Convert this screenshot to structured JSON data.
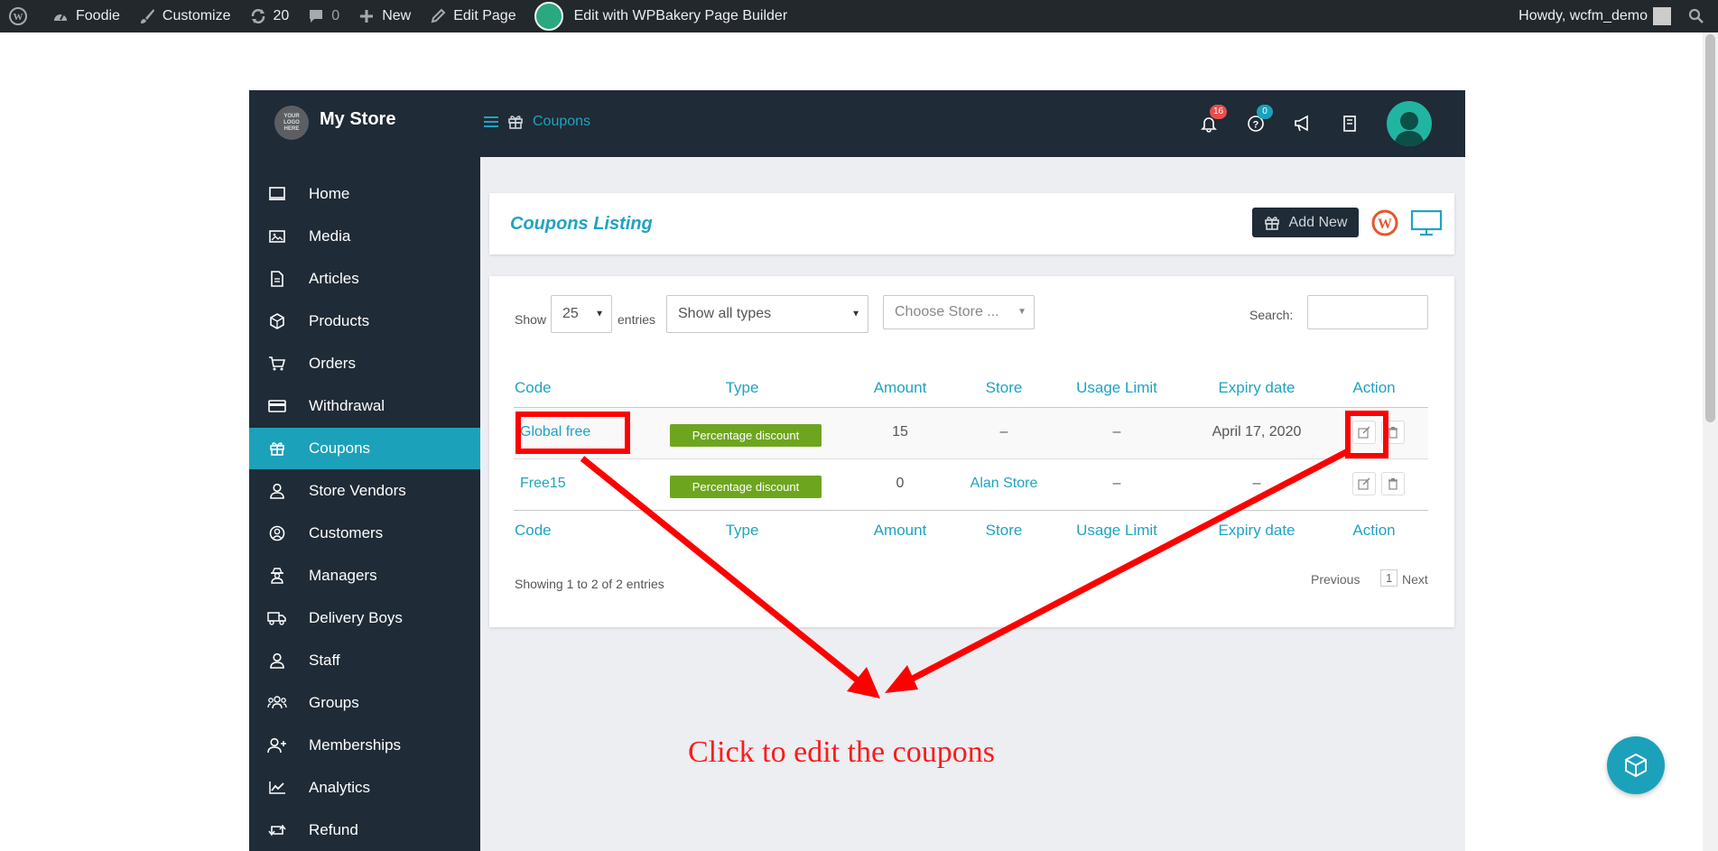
{
  "adminbar": {
    "site": "Foodie",
    "customize": "Customize",
    "updates": "20",
    "comments": "0",
    "new": "New",
    "edit_page": "Edit Page",
    "wpbakery": "Edit with WPBakery Page Builder",
    "howdy": "Howdy, wcfm_demo"
  },
  "header": {
    "logo_text": "YOUR LOGO HERE",
    "store_name": "My Store",
    "breadcrumb": "Coupons",
    "notifications_count": "16",
    "help_count": "0"
  },
  "sidebar": {
    "items": [
      {
        "label": "Home",
        "icon": "monitor-icon"
      },
      {
        "label": "Media",
        "icon": "image-icon"
      },
      {
        "label": "Articles",
        "icon": "document-icon"
      },
      {
        "label": "Products",
        "icon": "cube-icon"
      },
      {
        "label": "Orders",
        "icon": "cart-icon"
      },
      {
        "label": "Withdrawal",
        "icon": "credit-card-icon"
      },
      {
        "label": "Coupons",
        "icon": "gift-icon",
        "active": true
      },
      {
        "label": "Store Vendors",
        "icon": "user-icon"
      },
      {
        "label": "Customers",
        "icon": "user-circle-icon"
      },
      {
        "label": "Managers",
        "icon": "user-secret-icon"
      },
      {
        "label": "Delivery Boys",
        "icon": "truck-icon"
      },
      {
        "label": "Staff",
        "icon": "user-icon"
      },
      {
        "label": "Groups",
        "icon": "users-icon"
      },
      {
        "label": "Memberships",
        "icon": "user-plus-icon"
      },
      {
        "label": "Analytics",
        "icon": "chart-line-icon"
      },
      {
        "label": "Refund",
        "icon": "retweet-icon"
      }
    ]
  },
  "listing": {
    "title": "Coupons Listing",
    "add_new": "Add New"
  },
  "filters": {
    "show_label": "Show",
    "entries_value": "25",
    "entries_label": "entries",
    "type_filter": "Show all types",
    "store_placeholder": "Choose Store ...",
    "search_label": "Search:",
    "search_value": ""
  },
  "table": {
    "columns": [
      "Code",
      "Type",
      "Amount",
      "Store",
      "Usage Limit",
      "Expiry date",
      "Action"
    ],
    "rows": [
      {
        "code": "Global free",
        "type": "Percentage discount",
        "amount": "15",
        "store": "–",
        "usage_limit": "–",
        "expiry": "April 17, 2020"
      },
      {
        "code": "Free15",
        "type": "Percentage discount",
        "amount": "0",
        "store": "Alan Store",
        "usage_limit": "–",
        "expiry": "–"
      }
    ],
    "info": "Showing 1 to 2 of 2 entries",
    "previous": "Previous",
    "page": "1",
    "next": "Next"
  },
  "annotation": {
    "text": "Click to edit the coupons",
    "color": "#ff0000"
  },
  "colors": {
    "accent": "#1ca1bb",
    "dark": "#1f2b36",
    "badge_red": "#e84e4e",
    "badge_blue": "#1ca1bb",
    "pill_green": "#6ea51f"
  }
}
